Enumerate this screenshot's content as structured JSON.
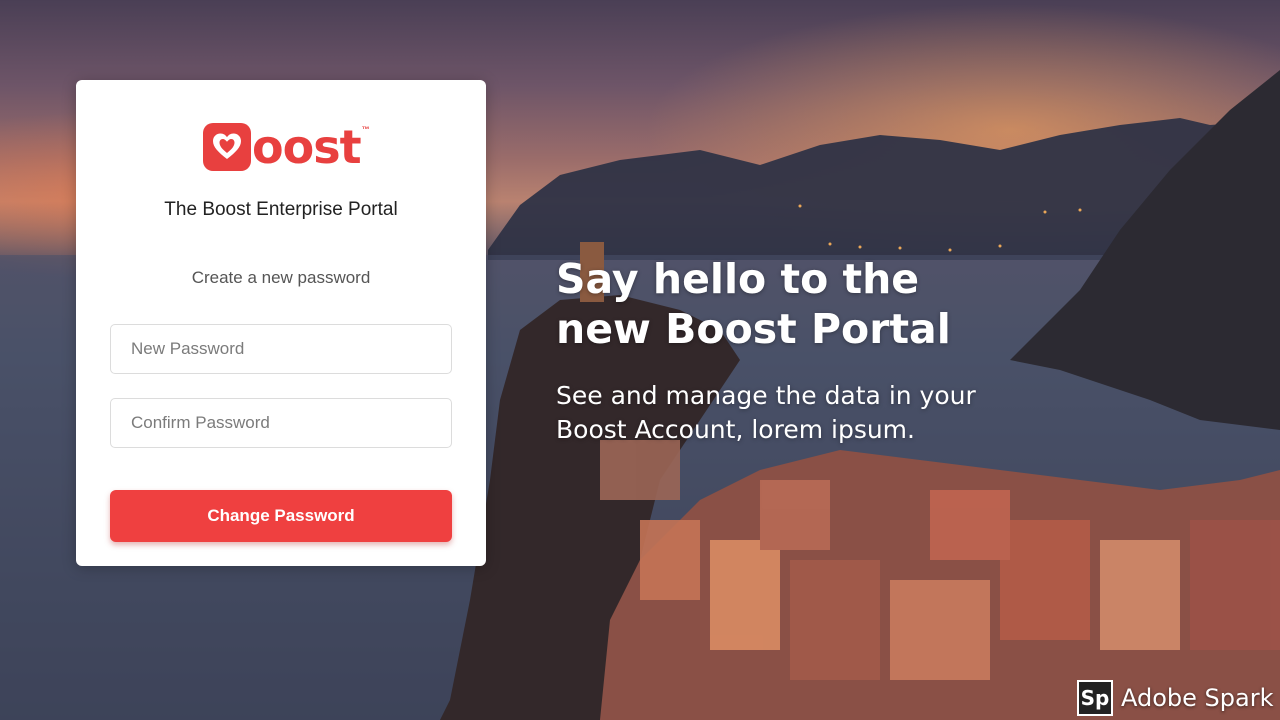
{
  "brand": {
    "logo_text": "oost",
    "logo_tm": "™",
    "logo_color": "#e8403f"
  },
  "card": {
    "portal_title": "The Boost Enterprise Portal",
    "subtitle": "Create a new password",
    "new_password_placeholder": "New Password",
    "confirm_password_placeholder": "Confirm Password",
    "submit_label": "Change Password",
    "button_color": "#ef4040"
  },
  "hero": {
    "title_line1": "Say hello to the",
    "title_line2": "new Boost Portal",
    "subtitle_line1": "See and manage the data in your",
    "subtitle_line2": "Boost Account, lorem ipsum."
  },
  "watermark": {
    "badge": "Sp",
    "label": "Adobe Spark"
  },
  "icons": {
    "logo": "boost-heart-logo-icon",
    "watermark": "adobe-spark-icon"
  }
}
